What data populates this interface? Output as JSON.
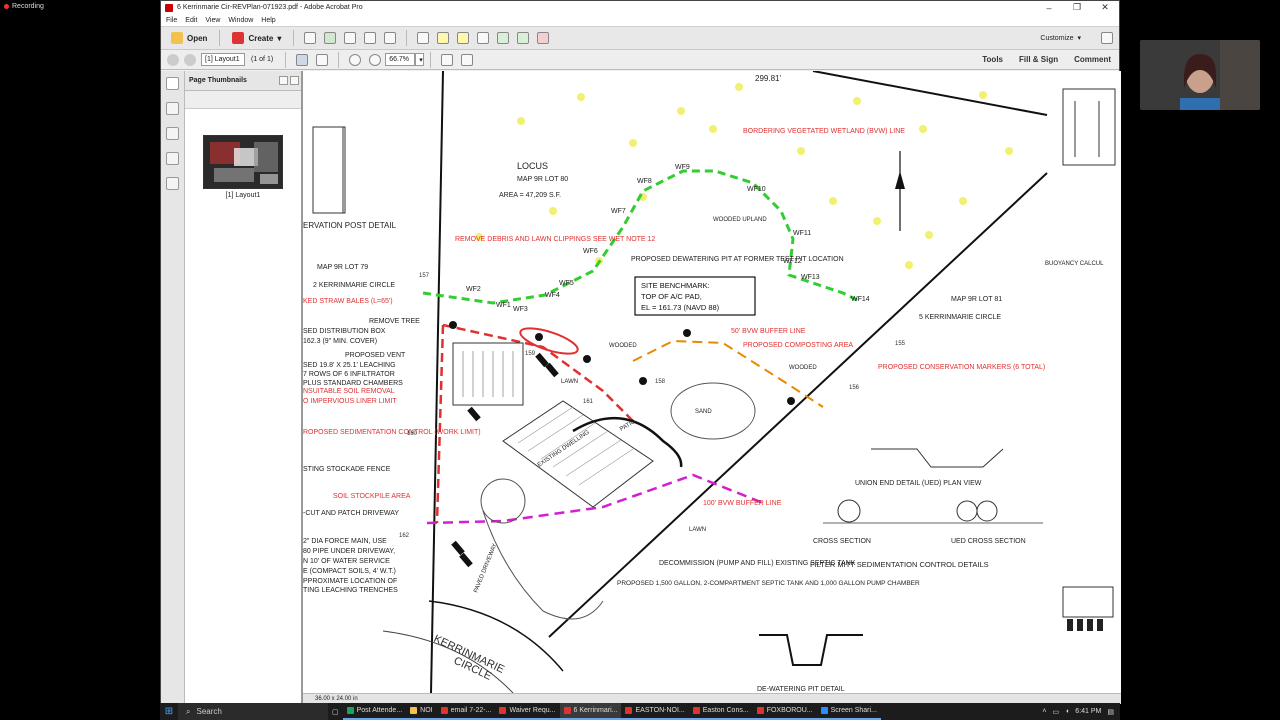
{
  "recording": {
    "label": "Recording"
  },
  "window": {
    "title": "6 Kerrinmarie Cir-REVPlan-071923.pdf - Adobe Acrobat Pro",
    "menus": [
      "File",
      "Edit",
      "View",
      "Window",
      "Help"
    ]
  },
  "toolbar": {
    "open_label": "Open",
    "create_label": "Create",
    "customize_label": "Customize"
  },
  "nav": {
    "page_field": "[1] Layout1",
    "page_count": "(1 of 1)",
    "zoom": "66.7%",
    "tools_label": "Tools",
    "fill_sign_label": "Fill & Sign",
    "comment_label": "Comment"
  },
  "thumbnails": {
    "title": "Page Thumbnails",
    "caption": "[1] Layout1"
  },
  "status": {
    "page_size": "36.00 x 24.00 in"
  },
  "plan": {
    "locus": "LOCUS",
    "locus_lot": "MAP 9R  LOT 80",
    "locus_area": "AREA = 47,209 S.F.",
    "left_lot": "MAP 9R  LOT 79",
    "left_addr": "2 KERRINMARIE CIRCLE",
    "right_lot": "MAP 9R  LOT 81",
    "right_addr": "5 KERRINMARIE CIRCLE",
    "wetland": "BORDERING VEGETATED WETLAND (BVW) LINE",
    "remove_debris": "REMOVE DEBRIS AND LAWN CLIPPINGS SEE WET NOTE 12",
    "dewatering_pit": "PROPOSED DEWATERING PIT AT FORMER TEST PIT LOCATION",
    "benchmark_1": "SITE BENCHMARK:",
    "benchmark_2": "TOP OF A/C PAD,",
    "benchmark_3": "EL = 161.73 (NAVD 88)",
    "buffer_50": "50' BVW BUFFER LINE",
    "composting": "PROPOSED COMPOSTING AREA",
    "conservation_markers": "PROPOSED CONSERVATION MARKERS (6 TOTAL)",
    "buffer_100": "100' BVW BUFFER LINE",
    "straw_bales": "KED STRAW BALES (L=65')",
    "remove_tree": "REMOVE TREE",
    "dist_box": "SED DISTRIBUTION BOX",
    "dist_box_el": "162.3 (9\" MIN. COVER)",
    "vent": "PROPOSED VENT",
    "leaching": "SED 19.8' X 25.1' LEACHING",
    "rows": "7 ROWS OF 6 INFILTRATOR",
    "chambers": "PLUS STANDARD CHAMBERS",
    "unsuitable": "NSUITABLE SOIL REMOVAL",
    "impervious": "O IMPERVIOUS LINER LIMIT",
    "sedimentation": "ROPOSED SEDIMENTATION CONTROL (WORK LIMIT)",
    "stockade": "STING STOCKADE FENCE",
    "stockpile": "SOIL STOCKPILE AREA",
    "cut_patch": "-CUT AND PATCH DRIVEWAY",
    "force_main": "2\" DIA FORCE MAIN, USE",
    "pipe": "80 PIPE UNDER DRIVEWAY,",
    "water_service": "N 10' OF WATER SERVICE",
    "compact": "E (COMPACT SOILS, 4' W.T.)",
    "approx": "PPROXIMATE LOCATION OF",
    "trenches": "TING LEACHING TRENCHES",
    "decommission": "DECOMMISSION (PUMP AND FILL) EXISTING SEPTIC TANK",
    "septic": "PROPOSED 1,500 GALLON, 2-COMPARTMENT SEPTIC TANK AND 1,000 GALLON PUMP CHAMBER",
    "street_1": "KERRINMARIE",
    "street_2": "CIRCLE",
    "post_detail": "ERVATION POST DETAIL",
    "filter_details": "FILTER MITT SEDIMENTATION CONTROL DETAILS",
    "ued_plan": "UNION END DETAIL (UED) PLAN VIEW",
    "cross_section": "CROSS SECTION",
    "ued_cross": "UED CROSS SECTION",
    "dewatering_detail": "DE-WATERING PIT DETAIL",
    "buoyancy": "BUOYANCY CALCUL",
    "wooded": "WOODED",
    "wooded_upland": "WOODED UPLAND",
    "lawn": "LAWN",
    "sand": "SAND",
    "patio": "PATIO",
    "paved": "PAVED DRIVEWAY",
    "garage": "EXISTING DWELLING",
    "wf": [
      "WF1",
      "WF2",
      "WF3",
      "WF4",
      "WF5",
      "WF6",
      "WF7",
      "WF8",
      "WF9",
      "WF10",
      "WF11",
      "WF12",
      "WF13",
      "WF14"
    ],
    "elevations": [
      "157",
      "158",
      "159",
      "160",
      "161",
      "162",
      "155",
      "156"
    ],
    "bearing": "299.81'"
  },
  "taskbar": {
    "search": "Search",
    "items": [
      "Post Attende...",
      "NOI",
      "email 7-22-...",
      "Waiver Requ...",
      "6 Kerrinmari...",
      "EASTON-NOI...",
      "Easton Cons...",
      "FOXBOROU...",
      "Screen Shari..."
    ],
    "time": "6:41 PM"
  },
  "colors": {
    "accent": "#1e88ff",
    "wetland": "#33cc33",
    "redline": "#e03030",
    "buffer_orange": "#e88a00",
    "buffer_magenta": "#d020d0"
  }
}
